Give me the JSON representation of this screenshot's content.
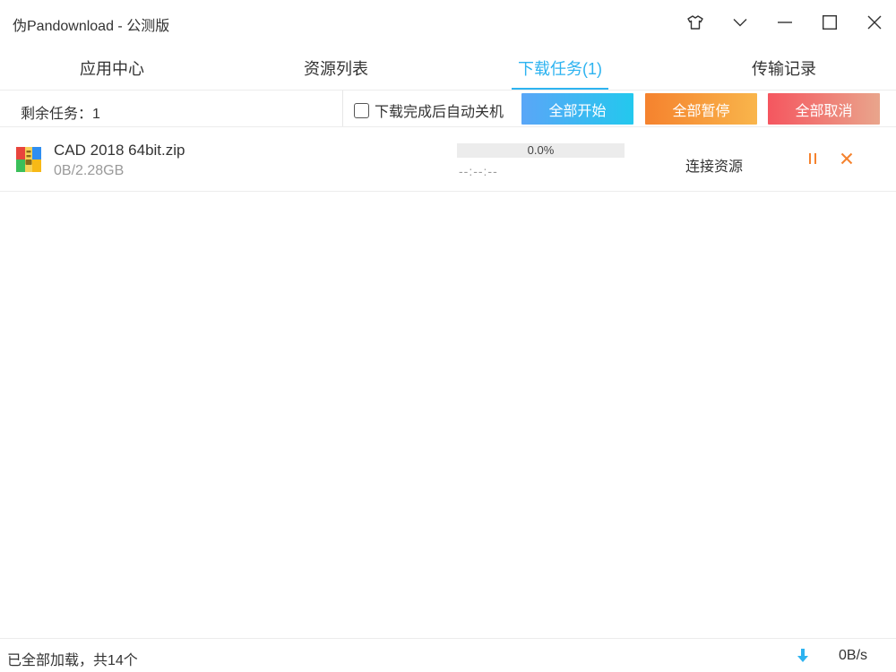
{
  "window": {
    "title": "伪Pandownload - 公测版"
  },
  "titlebar_buttons": [
    {
      "name": "skin-icon"
    },
    {
      "name": "chevron-down-icon"
    },
    {
      "name": "minimize-icon"
    },
    {
      "name": "maximize-icon"
    },
    {
      "name": "close-icon"
    }
  ],
  "tabs": [
    {
      "label": "应用中心",
      "active": false
    },
    {
      "label": "资源列表",
      "active": false
    },
    {
      "label": "下载任务(1)",
      "active": true
    },
    {
      "label": "传输记录",
      "active": false
    }
  ],
  "toolbar": {
    "remaining": "剩余任务：1",
    "auto_shutdown_label": "下载完成后自动关机",
    "auto_shutdown_checked": false,
    "start_all": "全部开始",
    "pause_all": "全部暂停",
    "cancel_all": "全部取消"
  },
  "tasks": [
    {
      "file_name": "CAD 2018 64bit.zip",
      "size": "0B/2.28GB",
      "progress_text": "0.0%",
      "progress": 0.0,
      "eta": "--:--:--",
      "status": "连接资源",
      "icon": "archive-file-icon"
    }
  ],
  "footer": {
    "loaded_text": "已全部加载，共14个",
    "speed": "0B/s",
    "icon": "download-arrow-icon"
  },
  "colors": {
    "accent": "#2db3f0",
    "start_gradient": [
      "#5aa6f7",
      "#23c8ee"
    ],
    "pause_gradient": [
      "#f5822e",
      "#f9b54b"
    ],
    "cancel_gradient": [
      "#f5565f",
      "#e9a58c"
    ],
    "row_action_orange": "#f5822e"
  }
}
